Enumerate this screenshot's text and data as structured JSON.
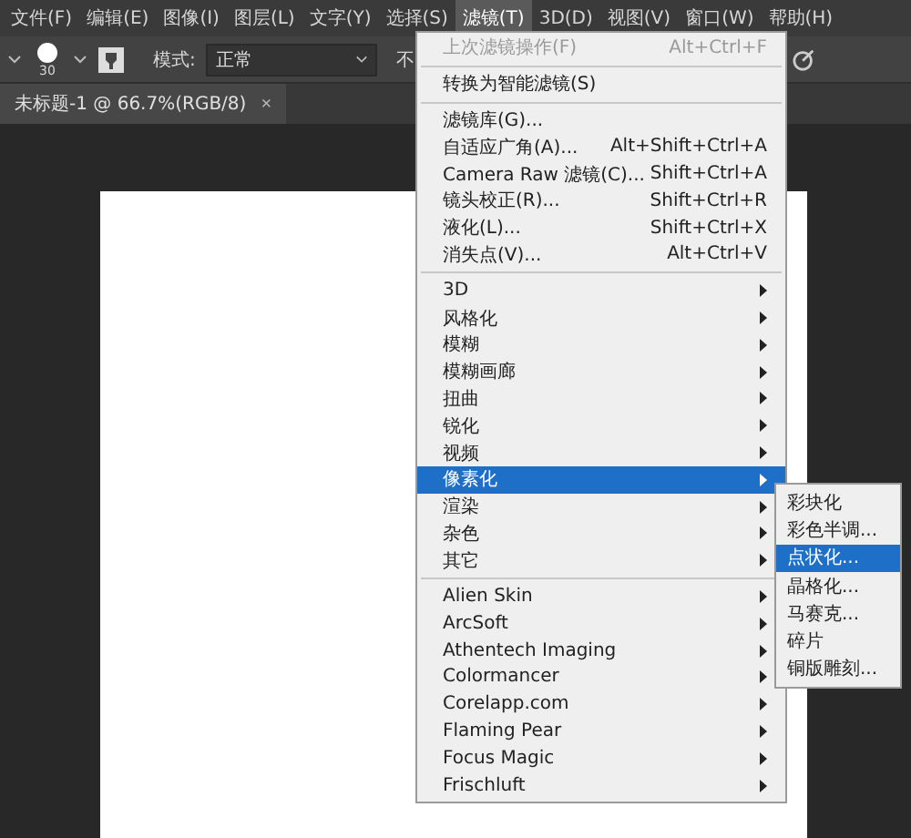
{
  "menubar": [
    {
      "label": "文件(F)",
      "selected": false
    },
    {
      "label": "编辑(E)",
      "selected": false
    },
    {
      "label": "图像(I)",
      "selected": false
    },
    {
      "label": "图层(L)",
      "selected": false
    },
    {
      "label": "文字(Y)",
      "selected": false
    },
    {
      "label": "选择(S)",
      "selected": false
    },
    {
      "label": "滤镜(T)",
      "selected": true
    },
    {
      "label": "3D(D)",
      "selected": false
    },
    {
      "label": "视图(V)",
      "selected": false
    },
    {
      "label": "窗口(W)",
      "selected": false
    },
    {
      "label": "帮助(H)",
      "selected": false
    }
  ],
  "options_bar": {
    "brush_size": "30",
    "mode_label": "模式:",
    "mode_value": "正常",
    "opacity_label": "不"
  },
  "document_tab": {
    "title": "未标题-1 @ 66.7%(RGB/8)",
    "close": "×"
  },
  "filter_menu": [
    [
      {
        "label": "上次滤镜操作(F)",
        "shortcut": "Alt+Ctrl+F",
        "disabled": true,
        "submenu": false,
        "selected": false
      }
    ],
    [
      {
        "label": "转换为智能滤镜(S)",
        "disabled": false,
        "submenu": false,
        "selected": false
      }
    ],
    [
      {
        "label": "滤镜库(G)...",
        "disabled": false,
        "submenu": false,
        "selected": false
      },
      {
        "label": "自适应广角(A)...",
        "shortcut": "Alt+Shift+Ctrl+A",
        "disabled": false,
        "submenu": false,
        "selected": false
      },
      {
        "label": "Camera Raw 滤镜(C)...",
        "shortcut": "Shift+Ctrl+A",
        "disabled": false,
        "submenu": false,
        "selected": false
      },
      {
        "label": "镜头校正(R)...",
        "shortcut": "Shift+Ctrl+R",
        "disabled": false,
        "submenu": false,
        "selected": false
      },
      {
        "label": "液化(L)...",
        "shortcut": "Shift+Ctrl+X",
        "disabled": false,
        "submenu": false,
        "selected": false
      },
      {
        "label": "消失点(V)...",
        "shortcut": "Alt+Ctrl+V",
        "disabled": false,
        "submenu": false,
        "selected": false
      }
    ],
    [
      {
        "label": "3D",
        "disabled": false,
        "submenu": true,
        "selected": false
      },
      {
        "label": "风格化",
        "disabled": false,
        "submenu": true,
        "selected": false
      },
      {
        "label": "模糊",
        "disabled": false,
        "submenu": true,
        "selected": false
      },
      {
        "label": "模糊画廊",
        "disabled": false,
        "submenu": true,
        "selected": false
      },
      {
        "label": "扭曲",
        "disabled": false,
        "submenu": true,
        "selected": false
      },
      {
        "label": "锐化",
        "disabled": false,
        "submenu": true,
        "selected": false
      },
      {
        "label": "视频",
        "disabled": false,
        "submenu": true,
        "selected": false
      },
      {
        "label": "像素化",
        "disabled": false,
        "submenu": true,
        "selected": true
      },
      {
        "label": "渲染",
        "disabled": false,
        "submenu": true,
        "selected": false
      },
      {
        "label": "杂色",
        "disabled": false,
        "submenu": true,
        "selected": false
      },
      {
        "label": "其它",
        "disabled": false,
        "submenu": true,
        "selected": false
      }
    ],
    [
      {
        "label": "Alien Skin",
        "disabled": false,
        "submenu": true,
        "selected": false
      },
      {
        "label": "ArcSoft",
        "disabled": false,
        "submenu": true,
        "selected": false
      },
      {
        "label": "Athentech Imaging",
        "disabled": false,
        "submenu": true,
        "selected": false
      },
      {
        "label": "Colormancer",
        "disabled": false,
        "submenu": true,
        "selected": false
      },
      {
        "label": "Corelapp.com",
        "disabled": false,
        "submenu": true,
        "selected": false
      },
      {
        "label": "Flaming Pear",
        "disabled": false,
        "submenu": true,
        "selected": false
      },
      {
        "label": "Focus Magic",
        "disabled": false,
        "submenu": true,
        "selected": false
      },
      {
        "label": "Frischluft",
        "disabled": false,
        "submenu": true,
        "selected": false
      }
    ]
  ],
  "pixelate_submenu": [
    {
      "label": "彩块化",
      "selected": false
    },
    {
      "label": "彩色半调...",
      "selected": false
    },
    {
      "label": "点状化...",
      "selected": true
    },
    {
      "label": "晶格化...",
      "selected": false
    },
    {
      "label": "马赛克...",
      "selected": false
    },
    {
      "label": "碎片",
      "selected": false
    },
    {
      "label": "铜版雕刻...",
      "selected": false
    }
  ]
}
